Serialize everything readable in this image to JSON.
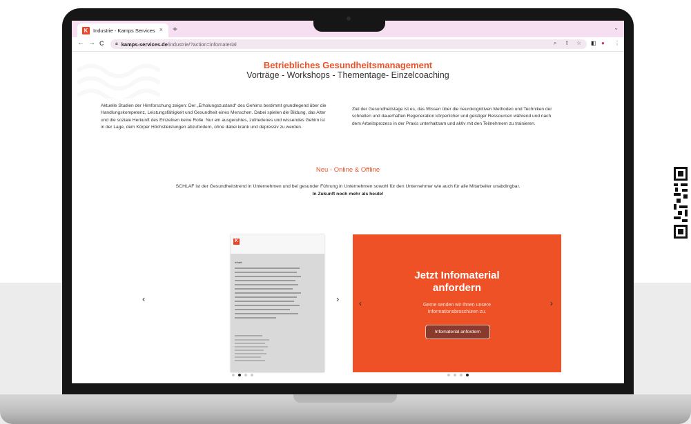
{
  "browser": {
    "tab_title": "Industrie - Kamps Services",
    "tab_close": "×",
    "new_tab": "+",
    "favicon_letter": "K",
    "url_host": "kamps-services.de",
    "url_path": "/industrie/?action=infomaterial"
  },
  "page": {
    "heading": "Betriebliches Gesundheitsmanagement",
    "subheading": "Vorträge - Workshops - Thementage- Einzelcoaching",
    "col_left": "Aktuelle Studien der Hirnforschung zeigen: Der „Erholungszustand“ des Gehirns bestimmt grundlegend über die Handlungskompetenz, Leistungsfähigkeit und Gesundheit eines Menschen. Dabei spielen die Bildung, das Alter und die soziale Herkunft des Einzelnen keine Rolle. Nur ein ausgeruhtes, zufriedenes und wissendes Gehirn ist in der Lage, dem Körper Höchstleistungen abzufordern, ohne dabei krank und depressiv zu werden.",
    "col_right": "Ziel der Gesundheitstage ist es, das Wissen über die neurokognitiven Methoden und Techniken der schnellen und dauerhaften Regeneration körperlicher und geistiger Ressourcen während und nach dem Arbeitsprozess in der Praxis unterhaltsam und aktiv mit den Teilnehmern zu trainieren.",
    "neu_heading": "Neu - Online & Offline",
    "schlaf_text": "SCHLAF ist der Gesundheitstrend in Unternehmen und bei gesunder Führung in Unternehmen sowohl für den Unternehmer wie auch für alle Mitarbeiter unabdingbar.",
    "schlaf_bold": "In Zukunft noch mehr als heute!",
    "brochure_heading": "Inhalt"
  },
  "promo": {
    "title_line1": "Jetzt Infomaterial",
    "title_line2": "anfordern",
    "text_line1": "Gerne senden wir Ihnen unsere",
    "text_line2": "Informationsbroschüren zu.",
    "button": "Infomaterial anfordern"
  },
  "carousel_left": {
    "active_dot": 1,
    "dot_count": 4
  },
  "carousel_right": {
    "active_dot": 3,
    "dot_count": 4
  },
  "colors": {
    "accent": "#ef5127",
    "dark_button": "#8a3a2c",
    "tab_bar": "#f5dff0"
  },
  "icons": {
    "prev": "‹",
    "next": "›",
    "back": "←",
    "forward": "→",
    "reload": "C",
    "lock": "🔒",
    "zoom": "⌕",
    "share": "⇧",
    "star": "☆",
    "menu": "⋮",
    "profile": "●",
    "sidepanel": "◧"
  }
}
